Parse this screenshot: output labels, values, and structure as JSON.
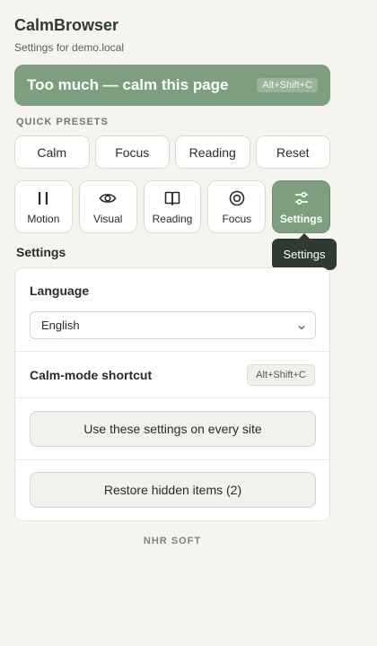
{
  "app": {
    "title": "CalmBrowser",
    "subtitle": "Settings for demo.local"
  },
  "calm_button": {
    "label": "Too much — calm this page",
    "shortcut": "Alt+Shift+C"
  },
  "presets": {
    "heading": "QUICK PRESETS",
    "items": [
      "Calm",
      "Focus",
      "Reading",
      "Reset"
    ]
  },
  "categories": {
    "items": [
      {
        "label": "Motion",
        "icon": "pause-icon",
        "active": false
      },
      {
        "label": "Visual",
        "icon": "eye-icon",
        "active": false
      },
      {
        "label": "Reading",
        "icon": "book-icon",
        "active": false
      },
      {
        "label": "Focus",
        "icon": "target-icon",
        "active": false
      },
      {
        "label": "Settings",
        "icon": "sliders-icon",
        "active": true
      }
    ]
  },
  "tooltip": "Settings",
  "settings": {
    "heading": "Settings",
    "language_label": "Language",
    "language_value": "English",
    "shortcut_label": "Calm-mode shortcut",
    "shortcut_value": "Alt+Shift+C",
    "use_everywhere_label": "Use these settings on every site",
    "restore_label": "Restore hidden items (2)"
  },
  "footer": "NHR SOFT",
  "colors": {
    "accent": "#7d9f7f",
    "background": "#f5f4ef",
    "tooltip": "#2f3a33"
  }
}
